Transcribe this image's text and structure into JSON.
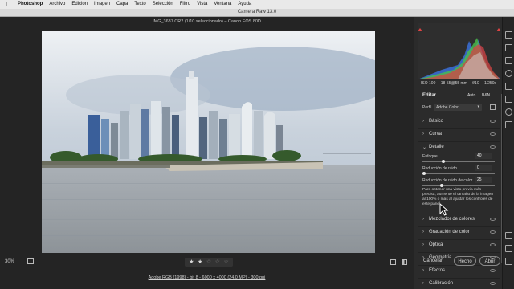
{
  "menubar": {
    "app": "Photoshop",
    "items": [
      "Archivo",
      "Edición",
      "Imagen",
      "Capa",
      "Texto",
      "Selección",
      "Filtro",
      "Vista",
      "Ventana",
      "Ayuda"
    ]
  },
  "window": {
    "title": "Camera Raw 13.0"
  },
  "document": {
    "title": "IMG_3637.CR2  (1/10 seleccionado)  –  Canon EOS 80D",
    "zoom": "30%",
    "rating_stars": [
      "★",
      "★",
      "☆",
      "☆",
      "☆"
    ],
    "rating_value": 2,
    "file_info": "Adobe RGB (1998) - bit 8 - 6000 x 4000 (24.0 MP) - 300 ppi"
  },
  "exif": [
    "ISO 100",
    "18-55@55 mm",
    "f/10",
    "1/250s"
  ],
  "editor": {
    "title": "Editar",
    "auto_label": "Auto",
    "bw_label": "B&N",
    "profile_label": "Perfil",
    "profile_value": "Adobe Color",
    "sections": {
      "basic": "Básico",
      "curve": "Curva",
      "detail": "Detalle",
      "color_mixer": "Mezclador de colores",
      "color_grading": "Gradación de color",
      "optics": "Óptica",
      "geometry": "Geometría",
      "effects": "Efectos",
      "calibration": "Calibración"
    },
    "detail": {
      "sharpening_label": "Enfoque",
      "sharpening_value": "40",
      "sharpening_fraction": 0.27,
      "noise_label": "Reducción de ruido",
      "noise_value": "0",
      "noise_fraction": 0.0,
      "color_noise_label": "Reducción de ruido de color",
      "color_noise_value": "25",
      "color_noise_fraction": 0.25,
      "note": "Para obtener una vista previa más precisa, aumente el tamaño de la imagen al 100% o más al ajustar los controles de este panel."
    }
  },
  "footer": {
    "cancel": "Cancelar",
    "done": "Hecho",
    "open": "Abrir"
  },
  "colors": {
    "accent_red": "#d44444",
    "histogram_blue": "#3a6fd8",
    "histogram_green": "#4bbf4b"
  }
}
